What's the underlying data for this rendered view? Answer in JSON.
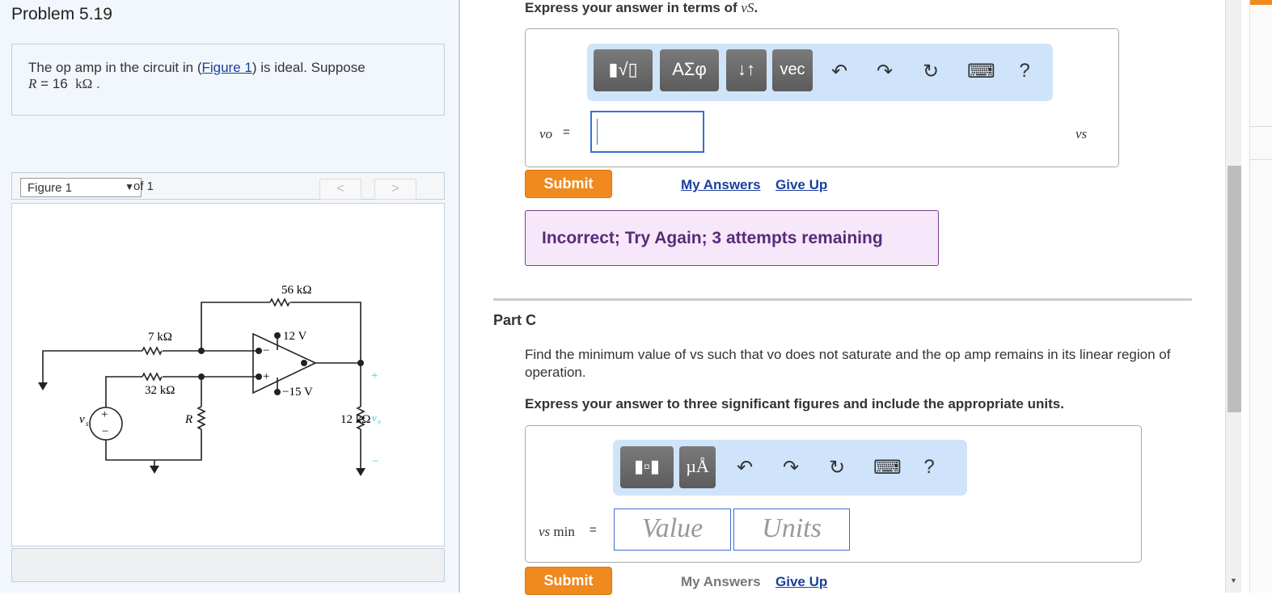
{
  "problem": {
    "title": "Problem 5.19",
    "text_pre": "The op amp in the circuit in (",
    "figure_link": "Figure 1",
    "text_post": ") is ideal. Suppose",
    "r_symbol": "R",
    "r_value": "= 16",
    "r_unit": "kΩ",
    "r_end": "."
  },
  "figure": {
    "select": "Figure 1",
    "of": "of 1",
    "prev": "<",
    "next": ">",
    "labels": {
      "r56": "56 kΩ",
      "r7": "7 kΩ",
      "r32": "32 kΩ",
      "r12": "12 kΩ",
      "rR": "R",
      "vs": "v",
      "vs_sub": "s",
      "vo": "v",
      "vo_sub": "o",
      "vpos": "12 V",
      "vneg": "−15 V",
      "plus": "+",
      "minus": "−",
      "inv": "−",
      "noninv": "+"
    }
  },
  "partB": {
    "instruction": "Express your answer in terms of ",
    "instruction_var": "vS",
    "instruction_end": ".",
    "toolbar": [
      "ΑΣφ",
      "↓↑",
      "vec"
    ],
    "icons": {
      "undo": "↶",
      "redo": "↷",
      "reset": "↻",
      "keyboard": "⌨",
      "help": "?"
    },
    "lhs": "vo",
    "eq": "=",
    "rhs": "vs",
    "submit": "Submit",
    "my_answers": "My Answers",
    "give_up": "Give Up",
    "feedback": "Incorrect; Try Again; 3 attempts remaining"
  },
  "partC": {
    "title": "Part C",
    "question": "Find the minimum value of vs such that vo does not saturate and the op amp remains in its linear region of operation.",
    "instruction": "Express your answer to three significant figures and include the appropriate units.",
    "toolbar": [
      "µÅ"
    ],
    "lhs": "vs",
    "lhs_sub": "min",
    "eq": "=",
    "value_placeholder": "Value",
    "units_placeholder": "Units",
    "submit": "Submit",
    "my_answers": "My Answers",
    "give_up": "Give Up"
  },
  "colors": {
    "accent": "#f0891e",
    "link": "#1a3f9c",
    "toolbar": "#cfe4fa",
    "feedback": "#f6e8fa"
  }
}
